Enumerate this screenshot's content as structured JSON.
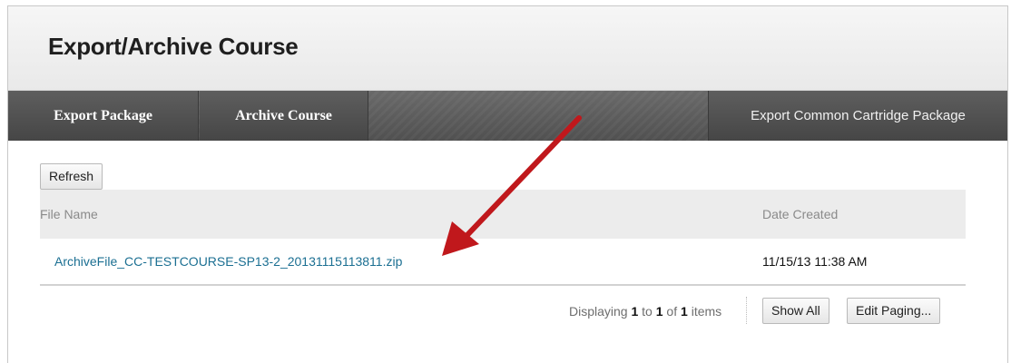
{
  "page": {
    "title": "Export/Archive Course"
  },
  "tabs": [
    {
      "label": "Export Package"
    },
    {
      "label": "Archive Course"
    },
    {
      "label": "Export Common Cartridge Package"
    }
  ],
  "toolbar": {
    "refresh_label": "Refresh"
  },
  "table": {
    "columns": [
      "File Name",
      "Date Created"
    ],
    "rows": [
      {
        "file_name": "ArchiveFile_CC-TESTCOURSE-SP13-2_20131115113811.zip",
        "date_created": "11/15/13 11:38 AM"
      }
    ]
  },
  "paging": {
    "prefix": "Displaying ",
    "start": "1",
    "to": " to ",
    "end": "1",
    "of": " of ",
    "total": "1",
    "suffix": " items",
    "show_all_label": "Show All",
    "edit_paging_label": "Edit Paging..."
  },
  "annotation": {
    "arrow_color": "#c0181c"
  }
}
